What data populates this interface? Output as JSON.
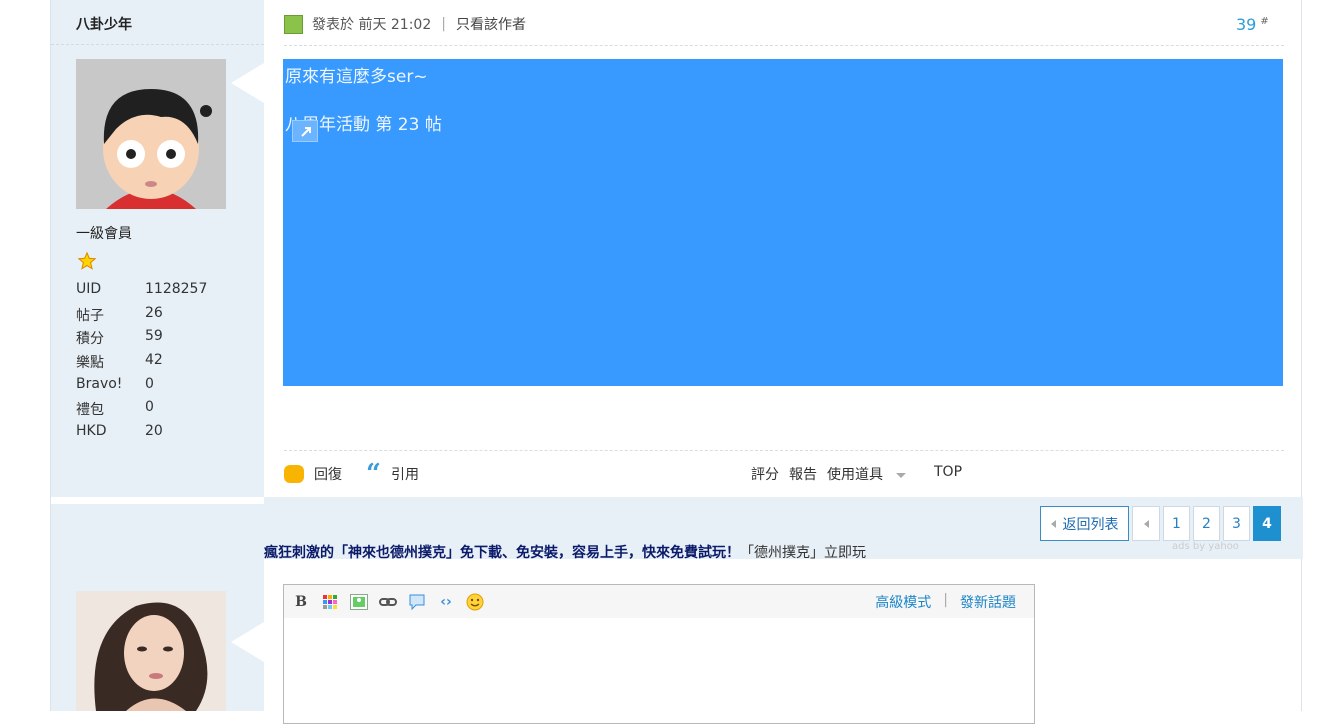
{
  "post": {
    "author": "八卦少年",
    "rank": "一級會員",
    "stats": [
      {
        "label": "UID",
        "value": "1128257"
      },
      {
        "label": "帖子",
        "value": "26"
      },
      {
        "label": "積分",
        "value": "59"
      },
      {
        "label": "樂點",
        "value": "42"
      },
      {
        "label": "Bravo!",
        "value": "0"
      },
      {
        "label": "禮包",
        "value": "0"
      },
      {
        "label": "HKD",
        "value": "20"
      }
    ],
    "posted_label": "發表於",
    "posted_time": "前天 21:02",
    "separator": "|",
    "only_author": "只看該作者",
    "floor": "39",
    "floor_mark": "#",
    "content_line1": "原來有這麼多ser~",
    "content_line2": "八周年活動 第 23 帖",
    "actions": {
      "reply": "回復",
      "quote": "引用",
      "rate": "評分",
      "report": "報告",
      "tools": "使用道具",
      "top": "TOP"
    }
  },
  "pager": {
    "back": "返回列表",
    "pages": [
      "1",
      "2",
      "3",
      "4"
    ],
    "current": "4"
  },
  "ad": {
    "headline": "瘋狂刺激的「神來也德州撲克」免下載、免安裝，容易上手，快來免費試玩！",
    "tail": "「德州撲克」立即玩",
    "ads_by": "ads by yahoo"
  },
  "editor": {
    "advanced": "高級模式",
    "new_topic": "發新話題",
    "separator": "|"
  },
  "colors": {
    "content_bg": "#3899ff",
    "link": "#2a9fd6",
    "current_page": "#1e90d0"
  }
}
